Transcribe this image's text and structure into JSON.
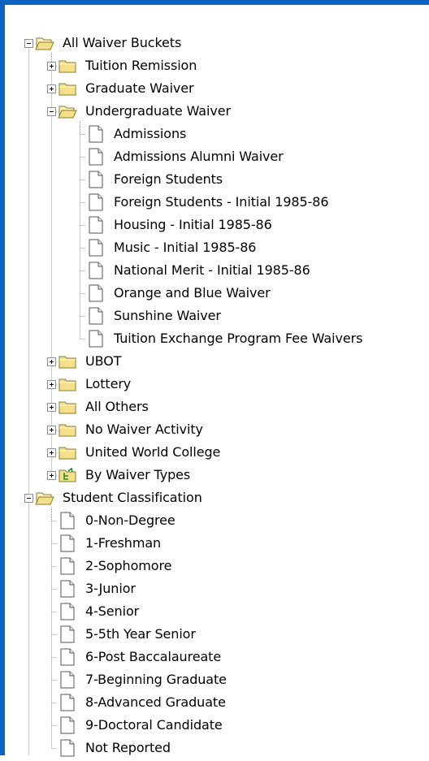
{
  "tree": [
    {
      "label": "All Waiver Buckets",
      "level": 0,
      "icon": "folder-open-icon",
      "expander": "minus"
    },
    {
      "label": "Tuition Remission",
      "level": 1,
      "icon": "folder-closed-icon",
      "expander": "plus"
    },
    {
      "label": "Graduate Waiver",
      "level": 1,
      "icon": "folder-closed-icon",
      "expander": "plus"
    },
    {
      "label": "Undergraduate Waiver",
      "level": 1,
      "icon": "folder-open-icon",
      "expander": "minus"
    },
    {
      "label": "Admissions",
      "level": 2,
      "icon": "page-icon"
    },
    {
      "label": "Admissions Alumni Waiver",
      "level": 2,
      "icon": "page-icon"
    },
    {
      "label": "Foreign Students",
      "level": 2,
      "icon": "page-icon"
    },
    {
      "label": "Foreign Students - Initial 1985-86",
      "level": 2,
      "icon": "page-icon"
    },
    {
      "label": "Housing - Initial 1985-86",
      "level": 2,
      "icon": "page-icon"
    },
    {
      "label": "Music - Initial 1985-86",
      "level": 2,
      "icon": "page-icon"
    },
    {
      "label": "National Merit - Initial 1985-86",
      "level": 2,
      "icon": "page-icon"
    },
    {
      "label": "Orange and Blue Waiver",
      "level": 2,
      "icon": "page-icon"
    },
    {
      "label": "Sunshine Waiver",
      "level": 2,
      "icon": "page-icon"
    },
    {
      "label": "Tuition Exchange Program Fee Waivers",
      "level": 2,
      "icon": "page-icon"
    },
    {
      "label": "UBOT",
      "level": 1,
      "icon": "folder-closed-icon",
      "expander": "plus"
    },
    {
      "label": "Lottery",
      "level": 1,
      "icon": "folder-closed-icon",
      "expander": "plus"
    },
    {
      "label": "All Others",
      "level": 1,
      "icon": "folder-closed-icon",
      "expander": "plus"
    },
    {
      "label": "No Waiver Activity",
      "level": 1,
      "icon": "folder-closed-icon",
      "expander": "plus"
    },
    {
      "label": "United World College",
      "level": 1,
      "icon": "folder-closed-icon",
      "expander": "plus"
    },
    {
      "label": "By Waiver Types",
      "level": 1,
      "icon": "hierarchy-folder-icon",
      "expander": "plus"
    },
    {
      "label": "Student Classification",
      "level": 0,
      "icon": "folder-open-icon",
      "expander": "minus"
    },
    {
      "label": "0-Non-Degree",
      "level": 1,
      "icon": "page-icon"
    },
    {
      "label": "1-Freshman",
      "level": 1,
      "icon": "page-icon"
    },
    {
      "label": "2-Sophomore",
      "level": 1,
      "icon": "page-icon"
    },
    {
      "label": "3-Junior",
      "level": 1,
      "icon": "page-icon"
    },
    {
      "label": "4-Senior",
      "level": 1,
      "icon": "page-icon"
    },
    {
      "label": "5-5th Year Senior",
      "level": 1,
      "icon": "page-icon"
    },
    {
      "label": "6-Post Baccalaureate",
      "level": 1,
      "icon": "page-icon"
    },
    {
      "label": "7-Beginning Graduate",
      "level": 1,
      "icon": "page-icon"
    },
    {
      "label": "8-Advanced Graduate",
      "level": 1,
      "icon": "page-icon"
    },
    {
      "label": "9-Doctoral Candidate",
      "level": 1,
      "icon": "page-icon"
    },
    {
      "label": "Not Reported",
      "level": 1,
      "icon": "page-icon"
    }
  ],
  "colors": {
    "frame": "#0a63c0",
    "folder_fill": "#f4e08a",
    "folder_edge": "#8a7a30",
    "connector": "#9a9a9a"
  }
}
